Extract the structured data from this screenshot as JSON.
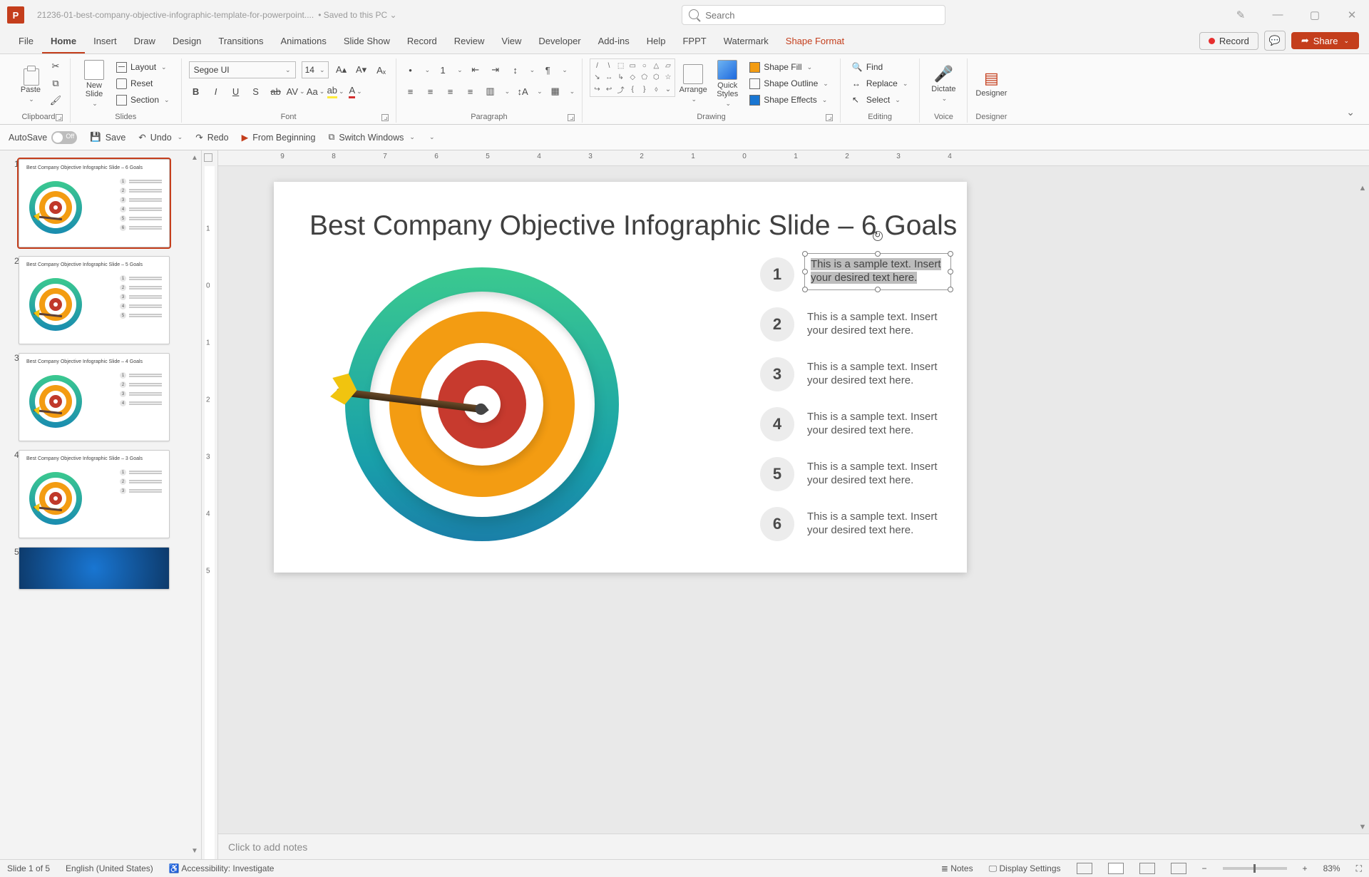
{
  "titlebar": {
    "app_letter": "P",
    "filename": "21236-01-best-company-objective-infographic-template-for-powerpoint....",
    "save_status": "• Saved to this PC ⌄",
    "search_placeholder": "Search"
  },
  "window_controls": {
    "pen": "✎",
    "min": "—",
    "max": "▢",
    "close": "✕"
  },
  "tabs": {
    "items": [
      "File",
      "Home",
      "Insert",
      "Draw",
      "Design",
      "Transitions",
      "Animations",
      "Slide Show",
      "Record",
      "Review",
      "View",
      "Developer",
      "Add-ins",
      "Help",
      "FPPT",
      "Watermark"
    ],
    "active": "Home",
    "context": "Shape Format",
    "record_btn": "Record",
    "share_btn": "Share",
    "comment_icon": "💬"
  },
  "ribbon": {
    "clipboard": {
      "paste": "Paste",
      "label": "Clipboard"
    },
    "slides": {
      "new_slide": "New\nSlide",
      "layout": "Layout",
      "reset": "Reset",
      "section": "Section",
      "label": "Slides"
    },
    "font": {
      "name": "Segoe UI",
      "size": "14",
      "inc": "A▴",
      "dec": "A▾",
      "clear": "Aₓ",
      "bold": "B",
      "italic": "I",
      "underline": "U",
      "shadow": "S",
      "strike": "ab",
      "spacing": "AV",
      "case": "Aa",
      "highlight": "ab",
      "color": "A",
      "label": "Font"
    },
    "paragraph": {
      "label": "Paragraph",
      "bullets": "•",
      "numbers": "1",
      "dec_indent": "⇤",
      "inc_indent": "⇥",
      "linespace": "↕",
      "dir": "¶",
      "al": "≡",
      "ac": "≡",
      "ar": "≡",
      "aj": "≡",
      "cols": "▥",
      "texta": "↕A",
      "convert": "▦"
    },
    "drawing": {
      "arrange": "Arrange",
      "quick": "Quick\nStyles",
      "fill": "Shape Fill",
      "outline": "Shape Outline",
      "effects": "Shape Effects",
      "label": "Drawing"
    },
    "editing": {
      "find": "Find",
      "replace": "Replace",
      "select": "Select",
      "label": "Editing"
    },
    "voice": {
      "dictate": "Dictate",
      "label": "Voice"
    },
    "designer": {
      "designer": "Designer",
      "label": "Designer"
    }
  },
  "qat": {
    "autosave": "AutoSave",
    "off": "Off",
    "save": "Save",
    "undo": "Undo",
    "redo": "Redo",
    "beginning": "From Beginning",
    "switch": "Switch Windows"
  },
  "thumbnails": [
    {
      "num": "1",
      "title": "Best Company Objective Infographic Slide – 6 Goals",
      "bullets": 6
    },
    {
      "num": "2",
      "title": "Best Company Objective Infographic Slide – 5 Goals",
      "bullets": 5
    },
    {
      "num": "3",
      "title": "Best Company Objective Infographic Slide – 4 Goals",
      "bullets": 4
    },
    {
      "num": "4",
      "title": "Best Company Objective Infographic Slide – 3 Goals",
      "bullets": 3
    },
    {
      "num": "5",
      "title": "",
      "bullets": 0
    }
  ],
  "ruler_h": [
    "9",
    "8",
    "7",
    "6",
    "5",
    "4",
    "3",
    "2",
    "1",
    "0",
    "1",
    "2",
    "3",
    "4"
  ],
  "ruler_v": [
    "1",
    "0",
    "1",
    "2",
    "3",
    "4",
    "5"
  ],
  "slide": {
    "title": "Best Company Objective Infographic Slide – 6 Goals",
    "goals": [
      {
        "n": "1",
        "txt": "This is a sample text. Insert your desired text here."
      },
      {
        "n": "2",
        "txt": "This is a sample text. Insert your desired text here."
      },
      {
        "n": "3",
        "txt": "This is a sample text. Insert your desired text here."
      },
      {
        "n": "4",
        "txt": "This is a sample text. Insert your desired text here."
      },
      {
        "n": "5",
        "txt": "This is a sample text. Insert your desired text here."
      },
      {
        "n": "6",
        "txt": "This is a sample text. Insert your desired text here."
      }
    ]
  },
  "notes_placeholder": "Click to add notes",
  "status": {
    "slide": "Slide 1 of 5",
    "lang": "English (United States)",
    "access": "Accessibility: Investigate",
    "notes": "Notes",
    "display": "Display Settings",
    "zoom": "83%"
  }
}
